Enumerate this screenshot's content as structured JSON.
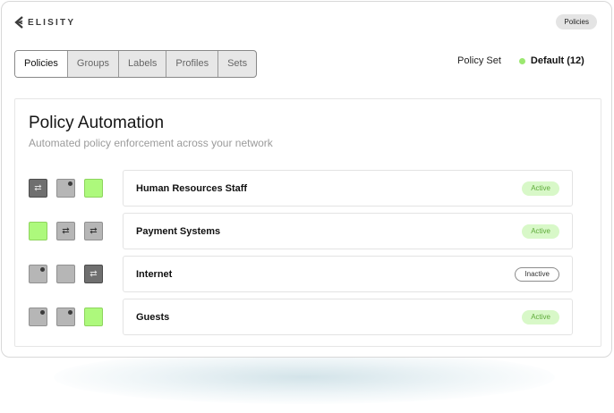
{
  "brand": {
    "name": "ELISITY"
  },
  "header": {
    "badge": "Policies"
  },
  "tabs": [
    {
      "label": "Policies",
      "active": true
    },
    {
      "label": "Groups",
      "active": false
    },
    {
      "label": "Labels",
      "active": false
    },
    {
      "label": "Profiles",
      "active": false
    },
    {
      "label": "Sets",
      "active": false
    }
  ],
  "policy_set": {
    "label": "Policy Set",
    "value": "Default (12)",
    "status_color": "#9be870"
  },
  "panel": {
    "title": "Policy Automation",
    "subtitle": "Automated policy enforcement across your network"
  },
  "policies": [
    {
      "name": "Human Resources Staff",
      "status": "Active",
      "icons": [
        {
          "style": "dark",
          "glyph": "arrows"
        },
        {
          "style": "light",
          "glyph": "dot"
        },
        {
          "style": "green",
          "glyph": "none"
        }
      ]
    },
    {
      "name": "Payment Systems",
      "status": "Active",
      "icons": [
        {
          "style": "green",
          "glyph": "none"
        },
        {
          "style": "light",
          "glyph": "arrows"
        },
        {
          "style": "light",
          "glyph": "arrows"
        }
      ]
    },
    {
      "name": "Internet",
      "status": "Inactive",
      "icons": [
        {
          "style": "light",
          "glyph": "dot"
        },
        {
          "style": "light",
          "glyph": "none"
        },
        {
          "style": "dark",
          "glyph": "arrows"
        }
      ]
    },
    {
      "name": "Guests",
      "status": "Active",
      "icons": [
        {
          "style": "light",
          "glyph": "dot"
        },
        {
          "style": "light",
          "glyph": "dot"
        },
        {
          "style": "green",
          "glyph": "none"
        }
      ]
    }
  ],
  "colors": {
    "active_bg": "#d8f8c8",
    "active_text": "#5eab3a",
    "green_icon": "#adf97c",
    "dark_icon": "#6f6f6f",
    "light_icon": "#b6b6b6"
  }
}
